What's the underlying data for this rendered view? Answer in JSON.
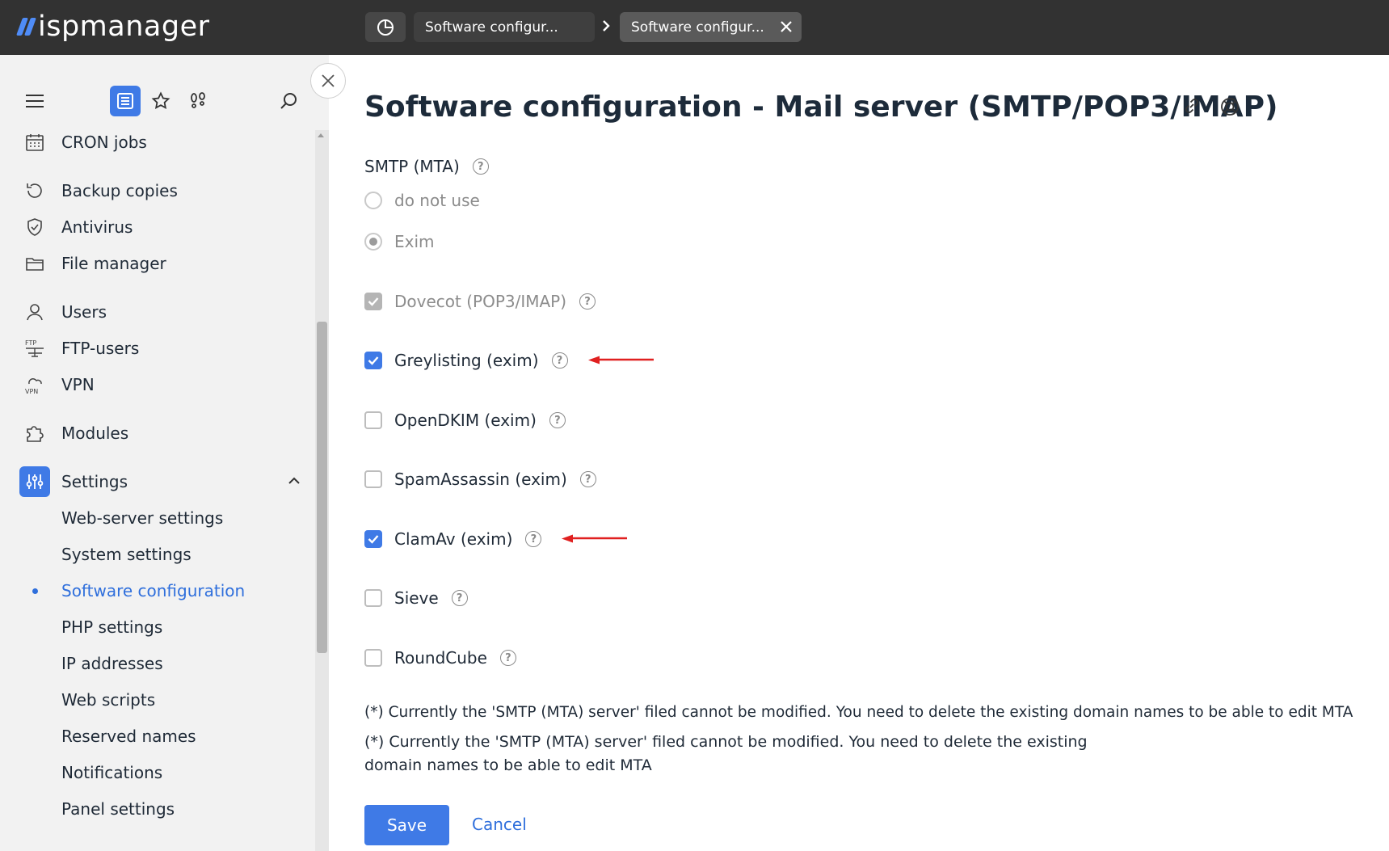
{
  "app": {
    "logo_text": "ispmanager"
  },
  "tabs": [
    {
      "label": "Software configur..."
    },
    {
      "label": "Software configur..."
    }
  ],
  "sidebar": {
    "items": [
      {
        "label": "CRON jobs",
        "icon": "calendar-icon"
      },
      {
        "label": "Backup copies",
        "icon": "backup-icon"
      },
      {
        "label": "Antivirus",
        "icon": "shield-icon"
      },
      {
        "label": "File manager",
        "icon": "folder-icon"
      },
      {
        "label": "Users",
        "icon": "user-icon"
      },
      {
        "label": "FTP-users",
        "icon": "ftp-icon"
      },
      {
        "label": "VPN",
        "icon": "vpn-icon"
      },
      {
        "label": "Modules",
        "icon": "puzzle-icon"
      },
      {
        "label": "Settings",
        "icon": "sliders-icon"
      }
    ],
    "settings_children": [
      {
        "label": "Web-server settings"
      },
      {
        "label": "System settings"
      },
      {
        "label": "Software configuration",
        "current": true
      },
      {
        "label": "PHP settings"
      },
      {
        "label": "IP addresses"
      },
      {
        "label": "Web scripts"
      },
      {
        "label": "Reserved names"
      },
      {
        "label": "Notifications"
      },
      {
        "label": "Panel settings"
      }
    ]
  },
  "main": {
    "title": "Software configuration - Mail server (SMTP/POP3/IMAP)",
    "smtp_label": "SMTP (MTA)",
    "help_glyph": "?",
    "radios": [
      {
        "label": "do not use",
        "checked": false
      },
      {
        "label": "Exim",
        "checked": true
      }
    ],
    "checkboxes": [
      {
        "label": "Dovecot (POP3/IMAP)",
        "checked": true,
        "disabled": true
      },
      {
        "label": "Greylisting (exim)",
        "checked": true,
        "disabled": false
      },
      {
        "label": "OpenDKIM (exim)",
        "checked": false,
        "disabled": false
      },
      {
        "label": "SpamAssassin (exim)",
        "checked": false,
        "disabled": false
      },
      {
        "label": "ClamAv (exim)",
        "checked": true,
        "disabled": false
      },
      {
        "label": "Sieve",
        "checked": false,
        "disabled": false
      },
      {
        "label": "RoundCube",
        "checked": false,
        "disabled": false
      }
    ],
    "note1": "(*) Currently the 'SMTP (MTA) server' filed cannot be modified. You need to delete the existing domain names to be able to edit MTA",
    "note2_line1": "(*) Currently the 'SMTP (MTA) server' filed cannot be modified. You need to delete the existing",
    "note2_line2": "domain names to be able to edit MTA",
    "save_label": "Save",
    "cancel_label": "Cancel"
  },
  "colors": {
    "accent": "#3f7ae6",
    "topbar": "#323232",
    "sidebar": "#f2f2f2",
    "arrow": "#e02020"
  }
}
